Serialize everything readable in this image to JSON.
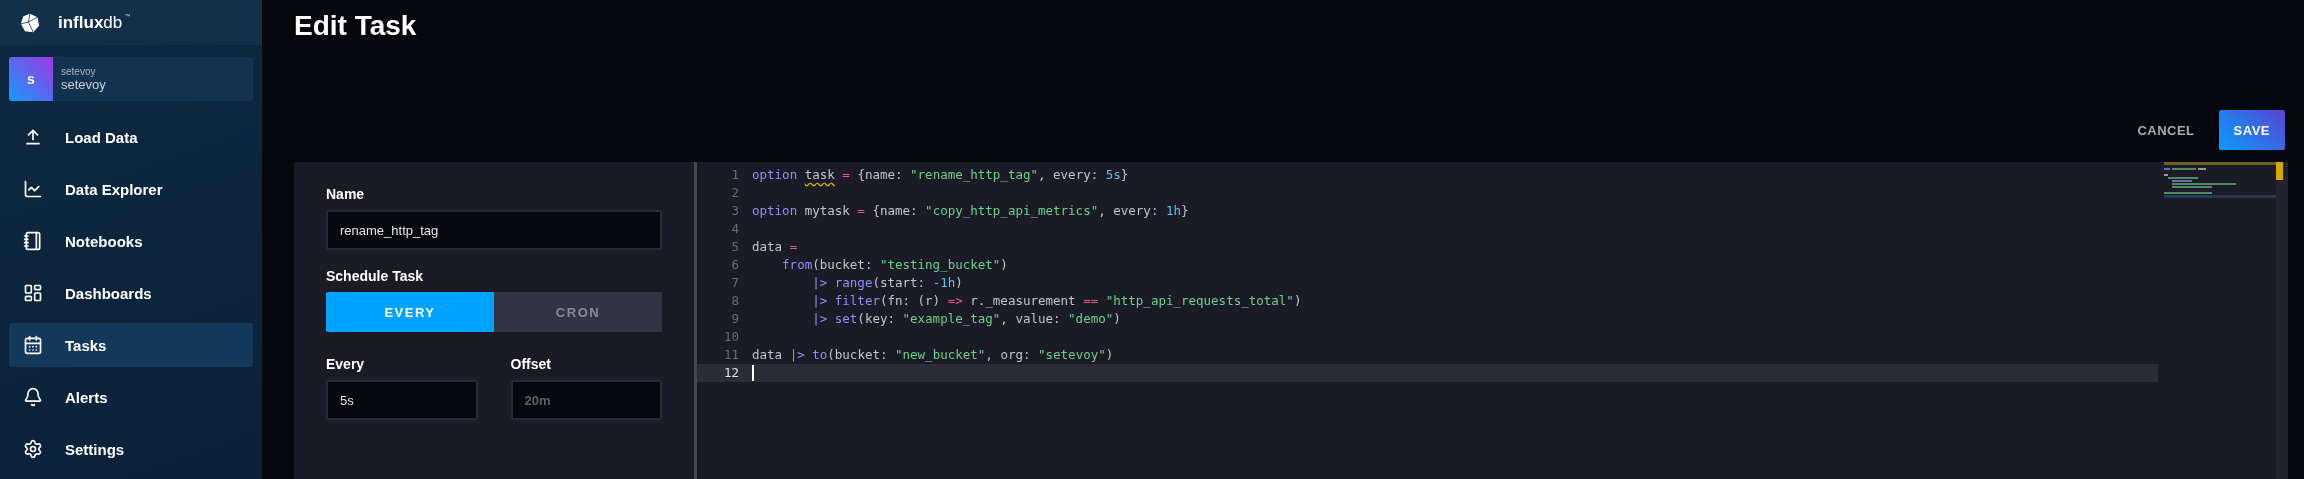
{
  "sidebar": {
    "brand": {
      "bold": "influx",
      "light": "db",
      "mark": "™"
    },
    "user": {
      "initial": "s",
      "org": "setevoy",
      "name": "setevoy"
    },
    "items": [
      {
        "label": "Load Data",
        "selected": false
      },
      {
        "label": "Data Explorer",
        "selected": false
      },
      {
        "label": "Notebooks",
        "selected": false
      },
      {
        "label": "Dashboards",
        "selected": false
      },
      {
        "label": "Tasks",
        "selected": true
      },
      {
        "label": "Alerts",
        "selected": false
      },
      {
        "label": "Settings",
        "selected": false
      }
    ]
  },
  "header": {
    "title": "Edit Task",
    "buttons": [
      {
        "label": "CANCEL",
        "kind": "text"
      },
      {
        "label": "SAVE",
        "kind": "primary"
      }
    ]
  },
  "form": {
    "name": {
      "label": "Name",
      "value": "rename_http_tag"
    },
    "schedule": {
      "label": "Schedule Task",
      "options": [
        {
          "label": "EVERY",
          "selected": true
        },
        {
          "label": "CRON",
          "selected": false
        }
      ]
    },
    "every": {
      "label": "Every",
      "value": "5s"
    },
    "offset": {
      "label": "Offset",
      "placeholder": "20m"
    }
  },
  "editor": {
    "lines": [
      {
        "number": "1",
        "current": false,
        "tokens": [
          {
            "kind": "keyword",
            "text": "option "
          },
          {
            "kind": "warning",
            "text": "task"
          },
          {
            "kind": "operator",
            "text": " = "
          },
          {
            "kind": "plain",
            "text": "{name: "
          },
          {
            "kind": "string",
            "text": "\"rename_http_tag\""
          },
          {
            "kind": "plain",
            "text": ", every: "
          },
          {
            "kind": "number",
            "text": "5s"
          },
          {
            "kind": "plain",
            "text": "}"
          }
        ]
      },
      {
        "number": "2",
        "current": false
      },
      {
        "number": "3",
        "current": false,
        "tokens": [
          {
            "kind": "keyword",
            "text": "option "
          },
          {
            "kind": "plain",
            "text": "mytask"
          },
          {
            "kind": "operator",
            "text": " = "
          },
          {
            "kind": "plain",
            "text": "{name: "
          },
          {
            "kind": "string",
            "text": "\"copy_http_api_metrics\""
          },
          {
            "kind": "plain",
            "text": ", every: "
          },
          {
            "kind": "number",
            "text": "1h"
          },
          {
            "kind": "plain",
            "text": "}"
          }
        ]
      },
      {
        "number": "4",
        "current": false
      },
      {
        "number": "5",
        "current": false,
        "tokens": [
          {
            "kind": "plain",
            "text": "data "
          },
          {
            "kind": "operator",
            "text": "="
          }
        ]
      },
      {
        "number": "6",
        "current": false,
        "kind": "call",
        "tokens": [
          {
            "kind": "keyword",
            "text": "from"
          },
          {
            "kind": "plain",
            "text": "(bucket: "
          },
          {
            "kind": "string",
            "text": "\"testing_bucket\""
          },
          {
            "kind": "plain",
            "text": ")"
          }
        ]
      },
      {
        "number": "7",
        "current": false,
        "kind": "pipe",
        "tokens": [
          {
            "kind": "keyword",
            "text": "|> range"
          },
          {
            "kind": "plain",
            "text": "(start: "
          },
          {
            "kind": "number",
            "text": "-1h"
          },
          {
            "kind": "plain",
            "text": ")"
          }
        ]
      },
      {
        "number": "8",
        "current": false,
        "kind": "pipe",
        "tokens": [
          {
            "kind": "keyword",
            "text": "|> filter"
          },
          {
            "kind": "plain",
            "text": "(fn: (r) "
          },
          {
            "kind": "operator",
            "text": "=>"
          },
          {
            "kind": "plain",
            "text": " r._measurement "
          },
          {
            "kind": "operator",
            "text": "== "
          },
          {
            "kind": "string",
            "text": "\"http_api_requests_total\""
          },
          {
            "kind": "plain",
            "text": ")"
          }
        ]
      },
      {
        "number": "9",
        "current": false,
        "kind": "pipe",
        "tokens": [
          {
            "kind": "keyword",
            "text": "|> set"
          },
          {
            "kind": "plain",
            "text": "(key: "
          },
          {
            "kind": "string",
            "text": "\"example_tag\""
          },
          {
            "kind": "plain",
            "text": ", value: "
          },
          {
            "kind": "string",
            "text": "\"demo\""
          },
          {
            "kind": "plain",
            "text": ")"
          }
        ]
      },
      {
        "number": "10",
        "current": false
      },
      {
        "number": "11",
        "current": false,
        "tokens": [
          {
            "kind": "plain",
            "text": "data "
          },
          {
            "kind": "keyword",
            "text": "|> to"
          },
          {
            "kind": "plain",
            "text": "(bucket: "
          },
          {
            "kind": "string",
            "text": "\"new_bucket\""
          },
          {
            "kind": "plain",
            "text": ", org: "
          },
          {
            "kind": "string",
            "text": "\"setevoy\""
          },
          {
            "kind": "plain",
            "text": ")"
          }
        ]
      },
      {
        "number": "12",
        "current": true
      }
    ]
  }
}
